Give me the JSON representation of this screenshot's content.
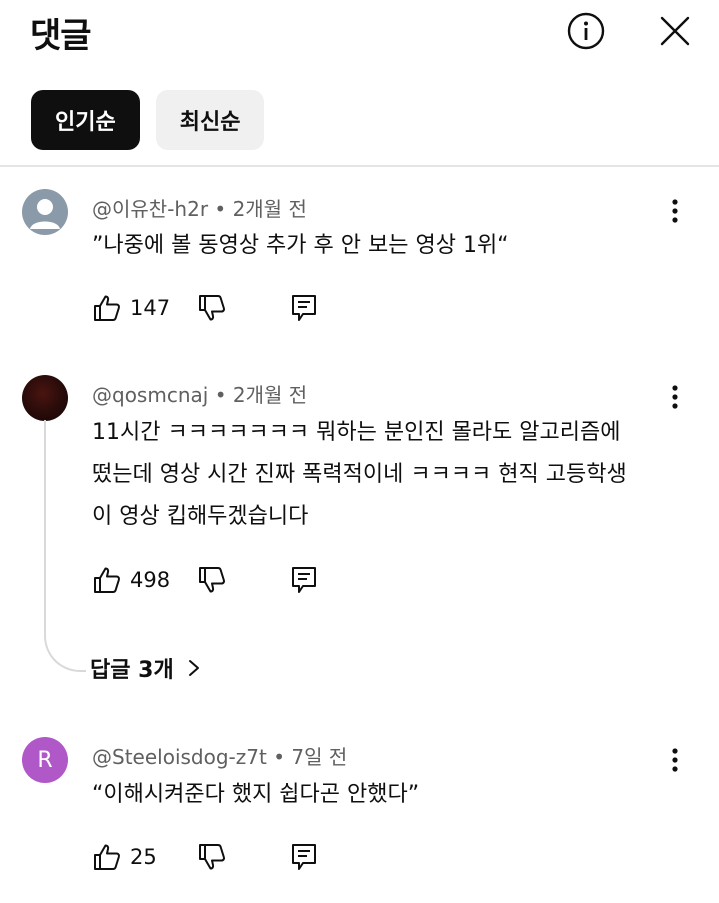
{
  "header": {
    "title": "댓글",
    "info_icon": "info-icon",
    "close_icon": "close-icon"
  },
  "sort_chips": [
    {
      "label": "인기순",
      "active": true
    },
    {
      "label": "최신순",
      "active": false
    }
  ],
  "comments": [
    {
      "author": "@이유찬-h2r",
      "time": "2개월 전",
      "text": "”나중에 볼 동영상 추가 후 안 보는 영상 1위“",
      "likes": "147",
      "avatar": {
        "type": "default-person",
        "color": "#8a9aa8"
      }
    },
    {
      "author": "@qosmcnaj",
      "time": "2개월 전",
      "text_lines": [
        "11시간 ㅋㅋㅋㅋㅋㅋㅋ 뭐하는 분인진 몰라도 알고리즘에",
        "떴는데 영상 시간 진짜 폭력적이네 ㅋㅋㅋㅋ 현직 고등학생",
        "이 영상 킵해두겠습니다"
      ],
      "likes": "498",
      "replies_label": "답글 3개",
      "avatar": {
        "type": "photo",
        "color": "#2a0c0a"
      }
    },
    {
      "author": "@Steeloisdog-z7t",
      "time": "7일 전",
      "text": "“이해시켜준다 했지 쉽다곤 안했다”",
      "likes": "25",
      "avatar": {
        "type": "letter",
        "letter": "R",
        "color": "#b158c8"
      }
    }
  ],
  "separator": "•"
}
